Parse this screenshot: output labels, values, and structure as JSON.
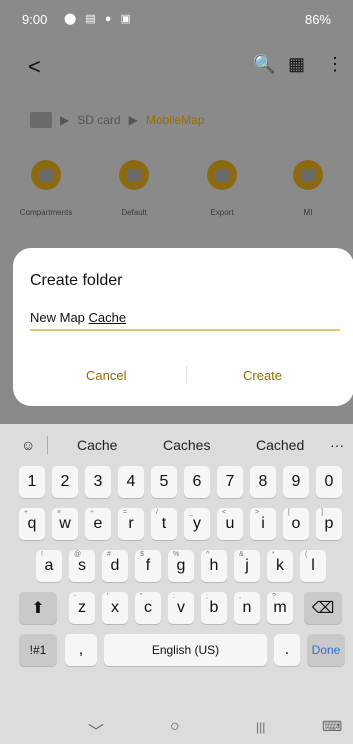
{
  "status": {
    "time": "9:00",
    "icons_left": "⬤ ▤ ● ▣",
    "right": "86%"
  },
  "appbar": {
    "back": "<",
    "search": "🔍",
    "grid": "▦",
    "more": "⋮"
  },
  "breadcrumb": {
    "sep": "▶",
    "sd": "SD card",
    "sep2": "▶",
    "current": "MobileMap"
  },
  "folders": [
    "Compartments",
    "Default",
    "Export",
    "MI"
  ],
  "dialog": {
    "title": "Create folder",
    "value_prefix": "New Map ",
    "value_suffix": "Cache",
    "cancel": "Cancel",
    "create": "Create"
  },
  "keyboard": {
    "suggestions": [
      "Cache",
      "Caches",
      "Cached"
    ],
    "toolbar_icon": "☺",
    "more": "···",
    "row1": [
      "1",
      "2",
      "3",
      "4",
      "5",
      "6",
      "7",
      "8",
      "9",
      "0"
    ],
    "row2": [
      "q",
      "w",
      "e",
      "r",
      "t",
      "y",
      "u",
      "i",
      "o",
      "p"
    ],
    "row2_sub": [
      "+",
      "×",
      "÷",
      "=",
      "/",
      "_",
      "<",
      ">",
      "[",
      "]"
    ],
    "row3": [
      "a",
      "s",
      "d",
      "f",
      "g",
      "h",
      "j",
      "k",
      "l"
    ],
    "row3_sub": [
      "!",
      "@",
      "#",
      "$",
      "%",
      "^",
      "&",
      "*",
      "("
    ],
    "row4": [
      "z",
      "x",
      "c",
      "v",
      "b",
      "n",
      "m"
    ],
    "row4_sub": [
      "-",
      "'",
      "\"",
      ":",
      ";",
      ",",
      "?"
    ],
    "shift": "⬆",
    "backspace": "⌫",
    "sym": "!#1",
    "comma": ",",
    "space": "English (US)",
    "period": ".",
    "done": "Done"
  },
  "navbar": {
    "back": "﹀",
    "home": "○",
    "recents": "|||",
    "keyboard": "⌨"
  }
}
